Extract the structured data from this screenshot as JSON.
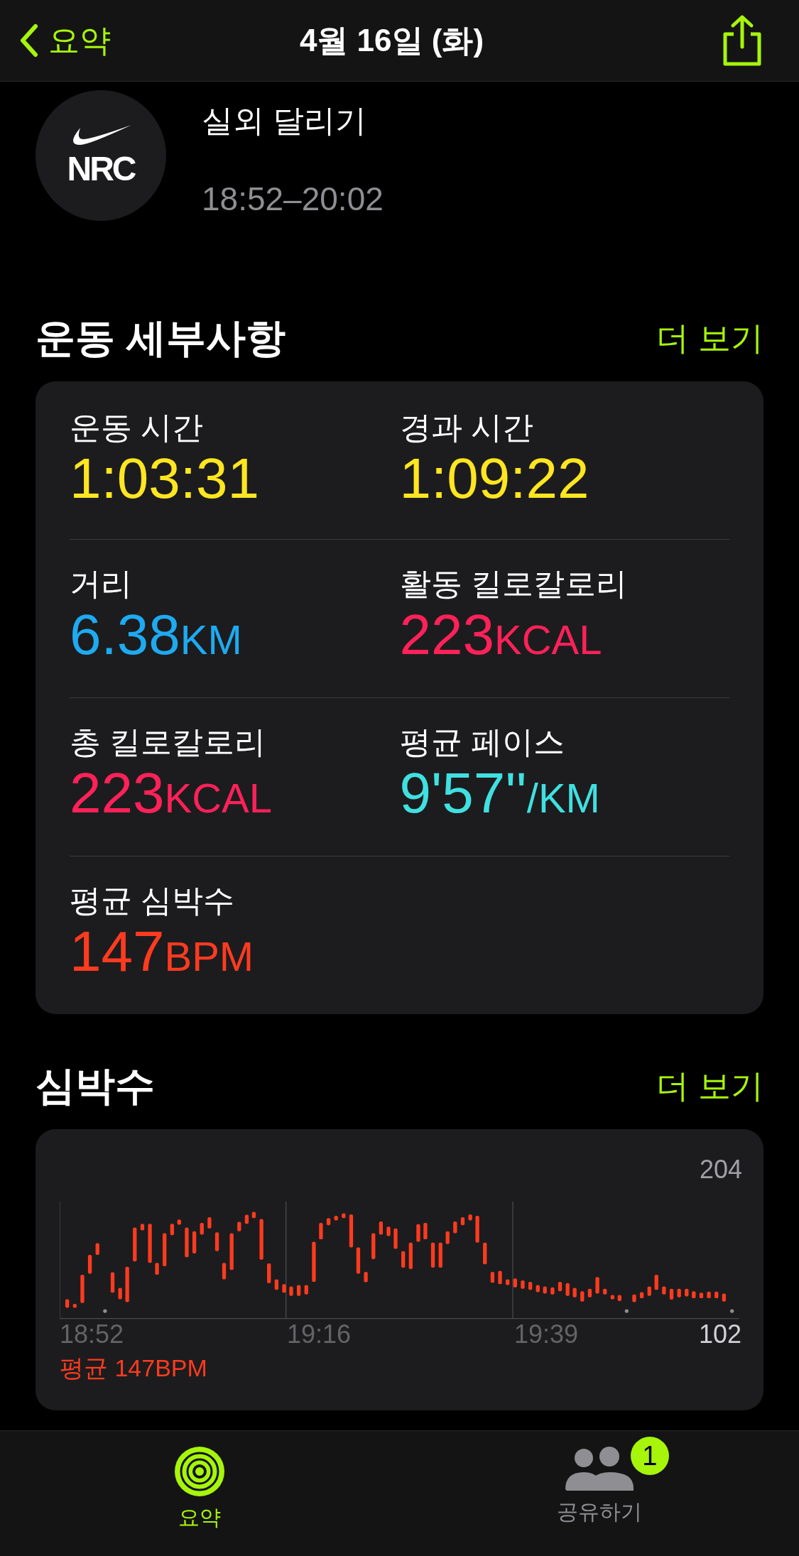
{
  "nav": {
    "back_label": "요약",
    "title": "4월 16일 (화)"
  },
  "workout": {
    "title": "실외 달리기",
    "time_range": "18:52–20:02",
    "logo_text": "NRC"
  },
  "details": {
    "title": "운동 세부사항",
    "more": "더 보기",
    "metrics": [
      {
        "label": "운동 시간",
        "value": "1:03:31",
        "color": "#ffe620"
      },
      {
        "label": "경과 시간",
        "value": "1:09:22",
        "color": "#ffe620"
      },
      {
        "label": "거리",
        "value": "6.38",
        "unit": "KM",
        "color": "#1eaaf1"
      },
      {
        "label": "활동 킬로칼로리",
        "value": "223",
        "unit": "KCAL",
        "color": "#ff2158"
      },
      {
        "label": "총 킬로칼로리",
        "value": "223",
        "unit": "KCAL",
        "color": "#ff2158"
      },
      {
        "label": "평균 페이스",
        "value": "9'57''",
        "unit": "/KM",
        "color": "#40e0e0"
      },
      {
        "label": "평균 심박수",
        "value": "147",
        "unit": "BPM",
        "color": "#ff3b1f"
      }
    ]
  },
  "heart_rate": {
    "title": "심박수",
    "more": "더 보기",
    "max_label": "204",
    "min_label": "102",
    "times": [
      "18:52",
      "19:16",
      "19:39"
    ],
    "average": "평균 147BPM"
  },
  "tabs": [
    {
      "label": "요약",
      "selected": true
    },
    {
      "label": "공유하기",
      "selected": false,
      "badge": "1"
    }
  ]
}
